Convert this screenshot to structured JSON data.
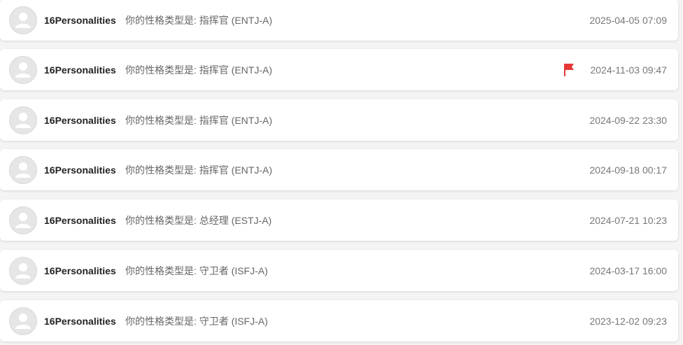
{
  "colors": {
    "flag": "#e53935",
    "sender": "#222222",
    "subject": "#666666",
    "date": "#777777"
  },
  "messages": [
    {
      "sender": "16Personalities",
      "subject": "你的性格类型是: 指挥官 (ENTJ-A)",
      "date": "2025-04-05 07:09",
      "flagged": false
    },
    {
      "sender": "16Personalities",
      "subject": "你的性格类型是: 指挥官 (ENTJ-A)",
      "date": "2024-11-03 09:47",
      "flagged": true
    },
    {
      "sender": "16Personalities",
      "subject": "你的性格类型是: 指挥官 (ENTJ-A)",
      "date": "2024-09-22 23:30",
      "flagged": false
    },
    {
      "sender": "16Personalities",
      "subject": "你的性格类型是: 指挥官 (ENTJ-A)",
      "date": "2024-09-18 00:17",
      "flagged": false
    },
    {
      "sender": "16Personalities",
      "subject": "你的性格类型是: 总经理 (ESTJ-A)",
      "date": "2024-07-21 10:23",
      "flagged": false
    },
    {
      "sender": "16Personalities",
      "subject": "你的性格类型是: 守卫者 (ISFJ-A)",
      "date": "2024-03-17 16:00",
      "flagged": false
    },
    {
      "sender": "16Personalities",
      "subject": "你的性格类型是: 守卫者 (ISFJ-A)",
      "date": "2023-12-02 09:23",
      "flagged": false
    }
  ]
}
